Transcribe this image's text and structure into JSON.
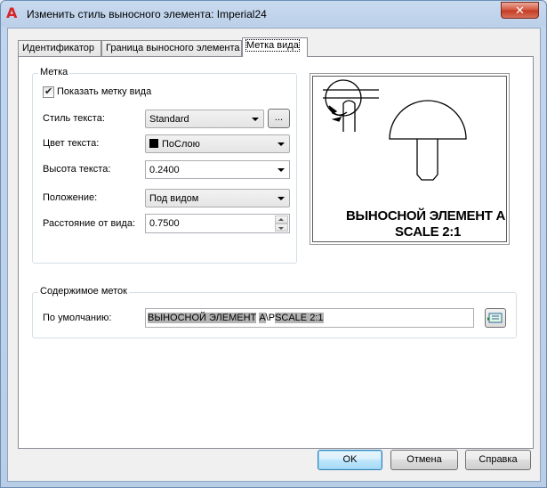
{
  "window": {
    "title": "Изменить стиль выносного элемента: Imperial24",
    "close_glyph": "✕",
    "app_icon_glyph": "A"
  },
  "tabs": [
    {
      "label": "Идентификатор"
    },
    {
      "label": "Граница выносного элемента"
    },
    {
      "label": "Метка вида",
      "active": true
    }
  ],
  "label_group": {
    "legend": "Метка",
    "show_label": {
      "label": "Показать метку вида",
      "checked": true
    },
    "text_style": {
      "label": "Стиль текста:",
      "value": "Standard",
      "ellipsis": "..."
    },
    "text_color": {
      "label": "Цвет текста:",
      "value": "ПоСлою",
      "swatch_color": "#000000"
    },
    "text_height": {
      "label": "Высота текста:",
      "value": "0.2400"
    },
    "placement": {
      "label": "Положение:",
      "value": "Под видом"
    },
    "offset": {
      "label": "Расстояние от вида:",
      "value": "0.7500"
    }
  },
  "preview": {
    "line1": "ВЫНОСНОЙ ЭЛЕМЕНТ А",
    "line2": "SCALE 2:1"
  },
  "contents_group": {
    "legend": "Содержимое меток",
    "default_label": "По умолчанию:",
    "default_value": {
      "seg1": "ВЫНОСНОЙ ЭЛЕМЕНТ",
      "seg2": " ",
      "seg3": "A",
      "seg4": "\\P",
      "seg5": "SCALE ",
      "seg6": "2:1"
    },
    "insert_field_icon": "insert-field-icon"
  },
  "buttons": {
    "ok": "OK",
    "cancel": "Отмена",
    "help": "Справка"
  }
}
